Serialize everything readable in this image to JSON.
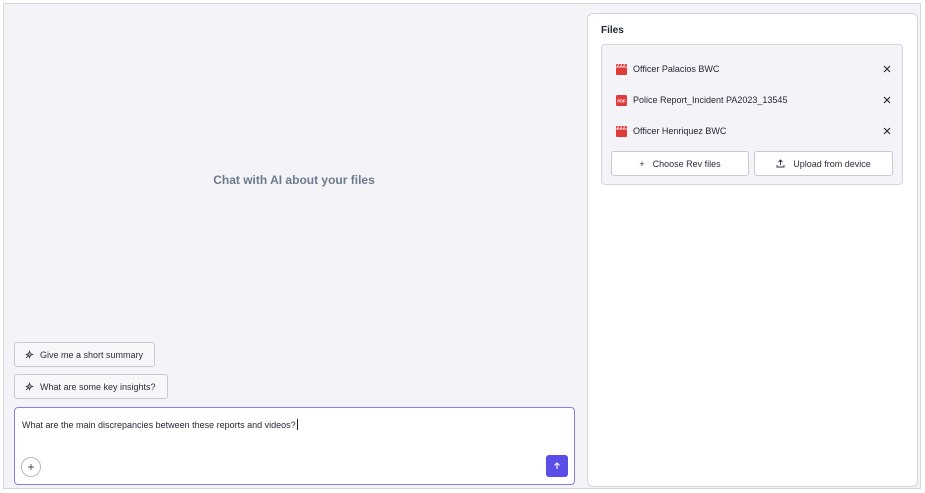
{
  "chat": {
    "empty_state": "Chat with AI about your files",
    "suggestions": [
      {
        "label": "Give me a short summary",
        "icon": "sparkle-icon"
      },
      {
        "label": "What are some key insights?",
        "icon": "sparkle-icon"
      }
    ],
    "input": {
      "value": "What are the main discrepancies between these reports and videos?",
      "attach_icon": "+",
      "send_icon": "arrow-up-icon"
    },
    "accent_color": "#5b4de8"
  },
  "files": {
    "title": "Files",
    "items": [
      {
        "name": "Officer Palacios BWC",
        "type": "video",
        "icon": "video-file-icon"
      },
      {
        "name": "Police Report_Incident PA2023_13545",
        "type": "pdf",
        "icon": "pdf-file-icon",
        "badge": "PDF"
      },
      {
        "name": "Officer Henriquez BWC",
        "type": "video",
        "icon": "video-file-icon"
      }
    ],
    "choose_button": {
      "label": "Choose Rev files",
      "icon": "+"
    },
    "upload_button": {
      "label": "Upload from device",
      "icon": "upload-icon"
    },
    "file_icon_color": "#e03b3b"
  }
}
